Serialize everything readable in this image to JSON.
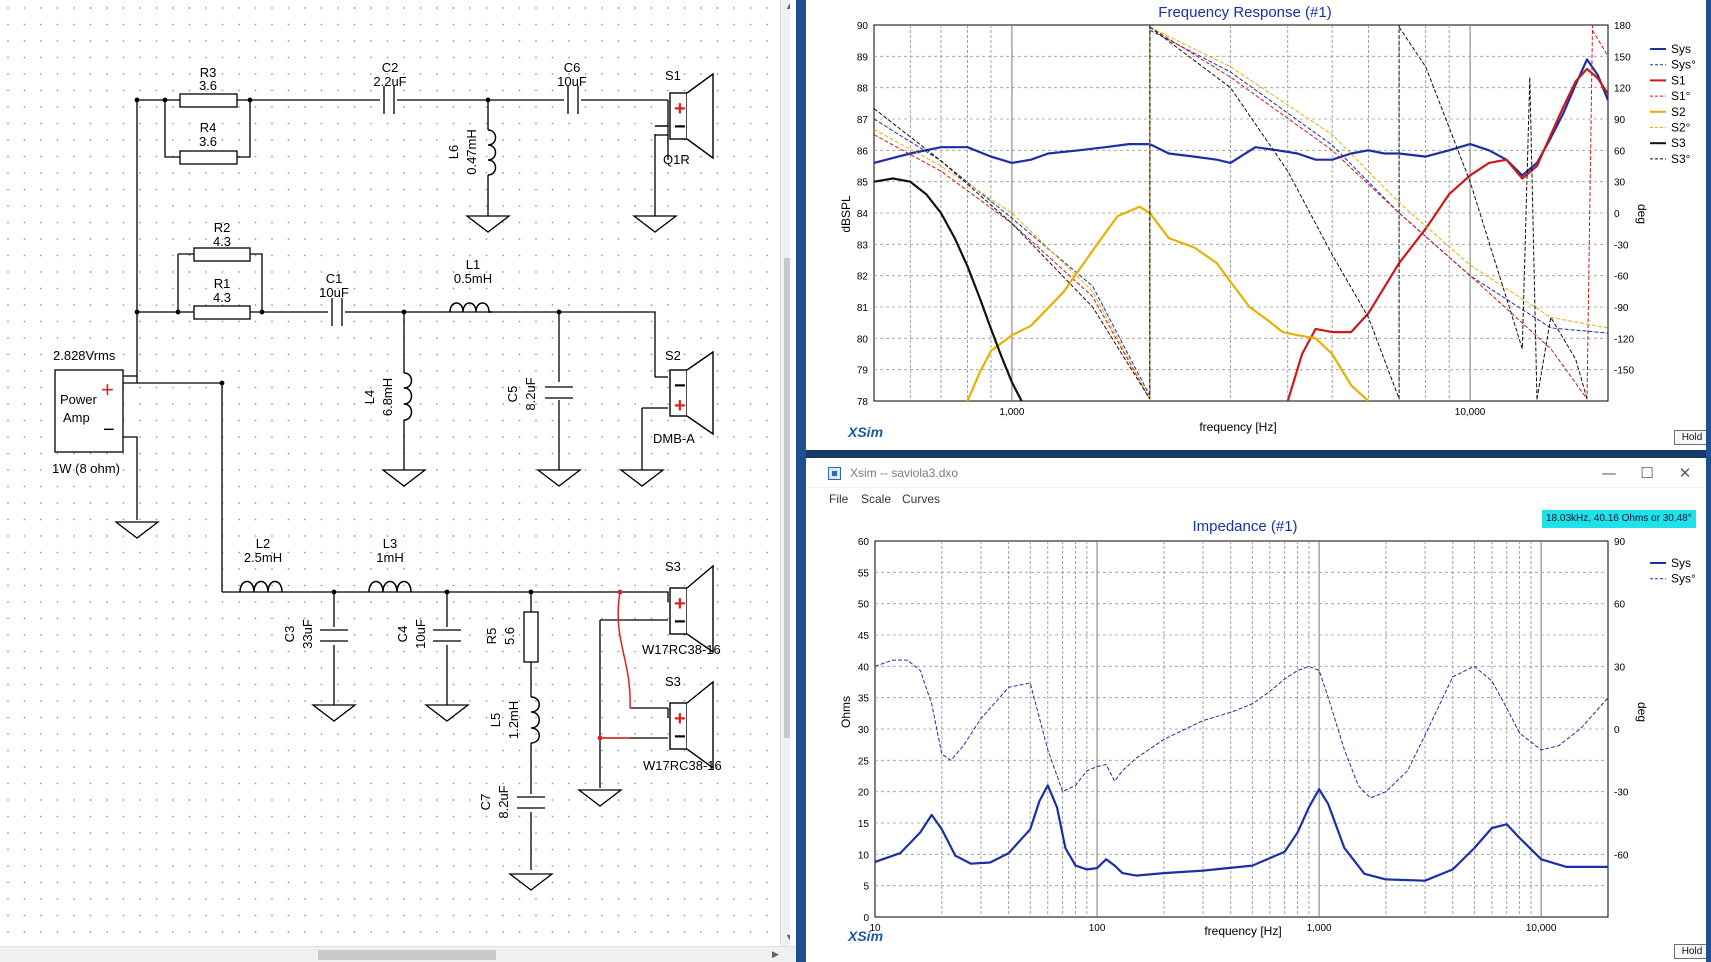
{
  "schematic": {
    "source": {
      "title": "2.828Vrms",
      "line1": "Power",
      "line2": "Amp",
      "plus": "+",
      "minus": "−",
      "power": "1W (8 ohm)"
    },
    "components": [
      {
        "id": "R3",
        "value": "3.6"
      },
      {
        "id": "R4",
        "value": "3.6"
      },
      {
        "id": "C2",
        "value": "2.2uF"
      },
      {
        "id": "C6",
        "value": "10uF"
      },
      {
        "id": "L6",
        "value": "0.47mH"
      },
      {
        "id": "R2",
        "value": "4.3"
      },
      {
        "id": "R1",
        "value": "4.3"
      },
      {
        "id": "C1",
        "value": "10uF"
      },
      {
        "id": "L1",
        "value": "0.5mH"
      },
      {
        "id": "L4",
        "value": "6.8mH"
      },
      {
        "id": "C5",
        "value": "8.2uF"
      },
      {
        "id": "L2",
        "value": "2.5mH"
      },
      {
        "id": "L3",
        "value": "1mH"
      },
      {
        "id": "C3",
        "value": "33uF"
      },
      {
        "id": "C4",
        "value": "10uF"
      },
      {
        "id": "R5",
        "value": "5.6"
      },
      {
        "id": "L5",
        "value": "1.2mH"
      },
      {
        "id": "C7",
        "value": "8.2uF"
      }
    ],
    "speakers": [
      {
        "id": "S1",
        "model": "Q1R",
        "plus": "+",
        "minus": "−"
      },
      {
        "id": "S2",
        "model": "DMB-A",
        "plus": "+",
        "minus": "−"
      },
      {
        "id": "S3",
        "model": "W17RC38-16",
        "plus": "+",
        "minus": "−"
      },
      {
        "id": "S3",
        "model": "W17RC38-16",
        "plus": "+",
        "minus": "−"
      }
    ],
    "wire_color": "#000000",
    "highlight_wire_color": "#e02020"
  },
  "freq_chart": {
    "title": "Frequency Response (#1)",
    "ylabel": "dBSPL",
    "ylabel_right": "deg",
    "xlabel": "frequency [Hz]",
    "brand": "XSim",
    "hold_label": "Hold",
    "y_ticks": [
      "90",
      "89",
      "88",
      "87",
      "86",
      "85",
      "84",
      "83",
      "82",
      "81",
      "80",
      "79",
      "78"
    ],
    "y_right_ticks": [
      "180",
      "150",
      "120",
      "90",
      "60",
      "30",
      "0",
      "-30",
      "-60",
      "-90",
      "-120",
      "-150"
    ],
    "x_ticks": [
      "1,000",
      "10,000"
    ],
    "legend": [
      {
        "name": "Sys",
        "color": "#1a2fa8",
        "style": "solid"
      },
      {
        "name": "Sys°",
        "color": "#1a2fa8",
        "style": "dashed"
      },
      {
        "name": "S1",
        "color": "#cc1a1a",
        "style": "solid"
      },
      {
        "name": "S1°",
        "color": "#cc1a1a",
        "style": "dashed"
      },
      {
        "name": "S2",
        "color": "#e8b000",
        "style": "solid"
      },
      {
        "name": "S2°",
        "color": "#e8b000",
        "style": "dashed"
      },
      {
        "name": "S3",
        "color": "#111111",
        "style": "solid"
      },
      {
        "name": "S3°",
        "color": "#111111",
        "style": "dashed"
      }
    ]
  },
  "impedance_window": {
    "window_title": "Xsim -- saviola3.dxo",
    "controls": {
      "minimize": "—",
      "maximize": "☐",
      "close": "✕"
    },
    "menu": [
      "File",
      "Scale",
      "Curves"
    ],
    "readout": "18.03kHz, 40.16 Ohms or 30.48°"
  },
  "imp_chart": {
    "title": "Impedance (#1)",
    "ylabel": "Ohms",
    "ylabel_right": "deg",
    "xlabel": "frequency [Hz]",
    "brand": "XSim",
    "hold_label": "Hold",
    "y_ticks": [
      "60",
      "55",
      "50",
      "45",
      "40",
      "35",
      "30",
      "25",
      "20",
      "15",
      "10",
      "5",
      "0"
    ],
    "y_right_ticks": [
      "90",
      "60",
      "30",
      "0",
      "-30",
      "-60"
    ],
    "x_ticks": [
      "10",
      "100",
      "1,000",
      "10,000"
    ],
    "legend": [
      {
        "name": "Sys",
        "color": "#1a2fa8",
        "style": "solid"
      },
      {
        "name": "Sys°",
        "color": "#1a2fa8",
        "style": "dashed"
      }
    ]
  },
  "chart_data": [
    {
      "type": "line",
      "title": "Frequency Response (#1)",
      "xlabel": "frequency [Hz]",
      "ylabel": "dBSPL",
      "y2label": "deg",
      "xscale": "log",
      "xlim": [
        500,
        20000
      ],
      "ylim": [
        78,
        90
      ],
      "y2lim": [
        -180,
        180
      ],
      "grid": true,
      "legend_position": "right",
      "series": [
        {
          "name": "Sys",
          "axis": "left",
          "color": "#1a2fa8",
          "style": "solid",
          "x": [
            500,
            600,
            700,
            800,
            900,
            1000,
            1100,
            1200,
            1400,
            1600,
            1800,
            2000,
            2200,
            2500,
            2800,
            3000,
            3400,
            3800,
            4200,
            4600,
            5000,
            5500,
            6000,
            6500,
            7000,
            8000,
            9000,
            10000,
            11000,
            12000,
            13000,
            14000,
            15000,
            16000,
            17000,
            18000,
            19000,
            20000
          ],
          "y": [
            85.6,
            85.9,
            86.1,
            86.1,
            85.8,
            85.6,
            85.7,
            85.9,
            86.0,
            86.1,
            86.2,
            86.2,
            85.9,
            85.8,
            85.7,
            85.6,
            86.1,
            86.0,
            85.9,
            85.7,
            85.7,
            85.9,
            86.0,
            85.9,
            85.9,
            85.8,
            86.0,
            86.2,
            86.0,
            85.7,
            85.2,
            85.6,
            86.4,
            87.2,
            88.1,
            88.9,
            88.4,
            87.6
          ]
        },
        {
          "name": "Sys°",
          "axis": "right",
          "color": "#1a2fa8",
          "style": "dashed",
          "x": [
            500,
            700,
            1000,
            1500,
            2000,
            2001,
            3000,
            5000,
            7000,
            10000,
            15000,
            20000
          ],
          "y": [
            90,
            50,
            -5,
            -70,
            -175,
            175,
            135,
            65,
            0,
            -60,
            -110,
            -115
          ]
        },
        {
          "name": "S1",
          "axis": "left",
          "color": "#cc1a1a",
          "style": "solid",
          "x": [
            4000,
            4300,
            4600,
            5000,
            5500,
            6000,
            7000,
            8000,
            9000,
            10000,
            11000,
            12000,
            13000,
            14000,
            15000,
            16000,
            17000,
            18000,
            19000,
            20000
          ],
          "y": [
            78.0,
            79.5,
            80.3,
            80.2,
            80.2,
            80.8,
            82.4,
            83.5,
            84.6,
            85.2,
            85.6,
            85.7,
            85.1,
            85.5,
            86.5,
            87.4,
            88.2,
            88.6,
            88.3,
            87.8
          ]
        },
        {
          "name": "S1°",
          "axis": "right",
          "color": "#cc1a1a",
          "style": "dashed",
          "x": [
            500,
            700,
            1000,
            1500,
            2000,
            2001,
            3000,
            5000,
            7000,
            10000,
            15000,
            18000,
            18500,
            20000
          ],
          "y": [
            75,
            40,
            -10,
            -80,
            -178,
            178,
            130,
            60,
            0,
            -60,
            -130,
            -178,
            175,
            150
          ]
        },
        {
          "name": "S2",
          "axis": "left",
          "color": "#e8b000",
          "style": "solid",
          "x": [
            800,
            850,
            900,
            1000,
            1100,
            1300,
            1500,
            1700,
            1900,
            2000,
            2200,
            2500,
            2800,
            3000,
            3300,
            3600,
            3900,
            4200,
            4600,
            5000,
            5500,
            6000
          ],
          "y": [
            78.0,
            78.9,
            79.6,
            80.1,
            80.4,
            81.5,
            82.8,
            83.9,
            84.2,
            84.0,
            83.2,
            82.9,
            82.4,
            81.8,
            81.0,
            80.6,
            80.2,
            80.1,
            80.0,
            79.5,
            78.5,
            78.0
          ]
        },
        {
          "name": "S2°",
          "axis": "right",
          "color": "#e8b000",
          "style": "dashed",
          "x": [
            500,
            700,
            1000,
            1500,
            2000,
            2001,
            3000,
            5000,
            7000,
            10000,
            15000,
            20000
          ],
          "y": [
            80,
            45,
            0,
            -75,
            -178,
            178,
            140,
            75,
            10,
            -50,
            -100,
            -110
          ]
        },
        {
          "name": "S3",
          "axis": "left",
          "color": "#111111",
          "style": "solid",
          "x": [
            500,
            550,
            600,
            650,
            700,
            750,
            800,
            850,
            900,
            950,
            1000,
            1050
          ],
          "y": [
            85.0,
            85.1,
            85.0,
            84.6,
            84.0,
            83.2,
            82.3,
            81.3,
            80.3,
            79.4,
            78.6,
            78.0
          ]
        },
        {
          "name": "S3°",
          "axis": "right",
          "color": "#111111",
          "style": "dashed",
          "x": [
            500,
            700,
            1000,
            1500,
            2000,
            2001,
            3000,
            4000,
            5000,
            6000,
            7000,
            7001,
            8000,
            10000,
            13000,
            13500,
            14000,
            15000,
            17000,
            18000
          ],
          "y": [
            100,
            50,
            -10,
            -90,
            -178,
            178,
            120,
            40,
            -40,
            -100,
            -178,
            178,
            140,
            30,
            -130,
            130,
            -178,
            -100,
            -140,
            -178
          ]
        }
      ]
    },
    {
      "type": "line",
      "title": "Impedance (#1)",
      "xlabel": "frequency [Hz]",
      "ylabel": "Ohms",
      "y2label": "deg",
      "xscale": "log",
      "xlim": [
        10,
        20000
      ],
      "ylim": [
        0,
        60
      ],
      "y2lim": [
        -90,
        90
      ],
      "grid": true,
      "legend_position": "top-right",
      "series": [
        {
          "name": "Sys",
          "axis": "left",
          "color": "#1a2fa8",
          "style": "solid",
          "x": [
            10,
            13,
            16,
            18,
            20,
            23,
            27,
            33,
            40,
            50,
            55,
            60,
            66,
            72,
            80,
            90,
            100,
            110,
            120,
            130,
            150,
            200,
            300,
            500,
            700,
            800,
            900,
            1000,
            1100,
            1300,
            1600,
            2000,
            3000,
            4000,
            5000,
            6000,
            7000,
            8000,
            10000,
            13000,
            16000,
            20000
          ],
          "y": [
            8.8,
            10.2,
            13.5,
            16.3,
            14.0,
            9.8,
            8.5,
            8.7,
            10.2,
            14.0,
            18.5,
            21.0,
            17.5,
            11.0,
            8.2,
            7.6,
            7.8,
            9.2,
            8.2,
            7.0,
            6.6,
            7.0,
            7.4,
            8.2,
            10.4,
            13.5,
            17.5,
            20.4,
            18.0,
            11.0,
            6.9,
            6.0,
            5.8,
            7.6,
            11.0,
            14.2,
            14.8,
            12.6,
            9.2,
            8.0,
            8.0,
            8.0
          ]
        },
        {
          "name": "Sys°",
          "axis": "right",
          "color": "#1a2fa8",
          "style": "dashed",
          "x": [
            10,
            12,
            14,
            16,
            18,
            20,
            22,
            25,
            30,
            40,
            50,
            60,
            70,
            80,
            90,
            100,
            110,
            120,
            130,
            150,
            200,
            300,
            400,
            500,
            600,
            700,
            800,
            900,
            1000,
            1100,
            1300,
            1500,
            1700,
            2000,
            2500,
            3000,
            4000,
            5000,
            6000,
            7000,
            8000,
            10000,
            12000,
            15000,
            20000
          ],
          "y": [
            30,
            33,
            33,
            28,
            12,
            -12,
            -15,
            -8,
            5,
            20,
            22,
            -10,
            -30,
            -27,
            -20,
            -18,
            -17,
            -25,
            -20,
            -14,
            -5,
            4,
            8,
            12,
            18,
            24,
            28,
            30,
            28,
            15,
            -10,
            -27,
            -33,
            -30,
            -20,
            -3,
            25,
            30,
            23,
            10,
            -2,
            -10,
            -8,
            0,
            15
          ]
        }
      ]
    }
  ]
}
